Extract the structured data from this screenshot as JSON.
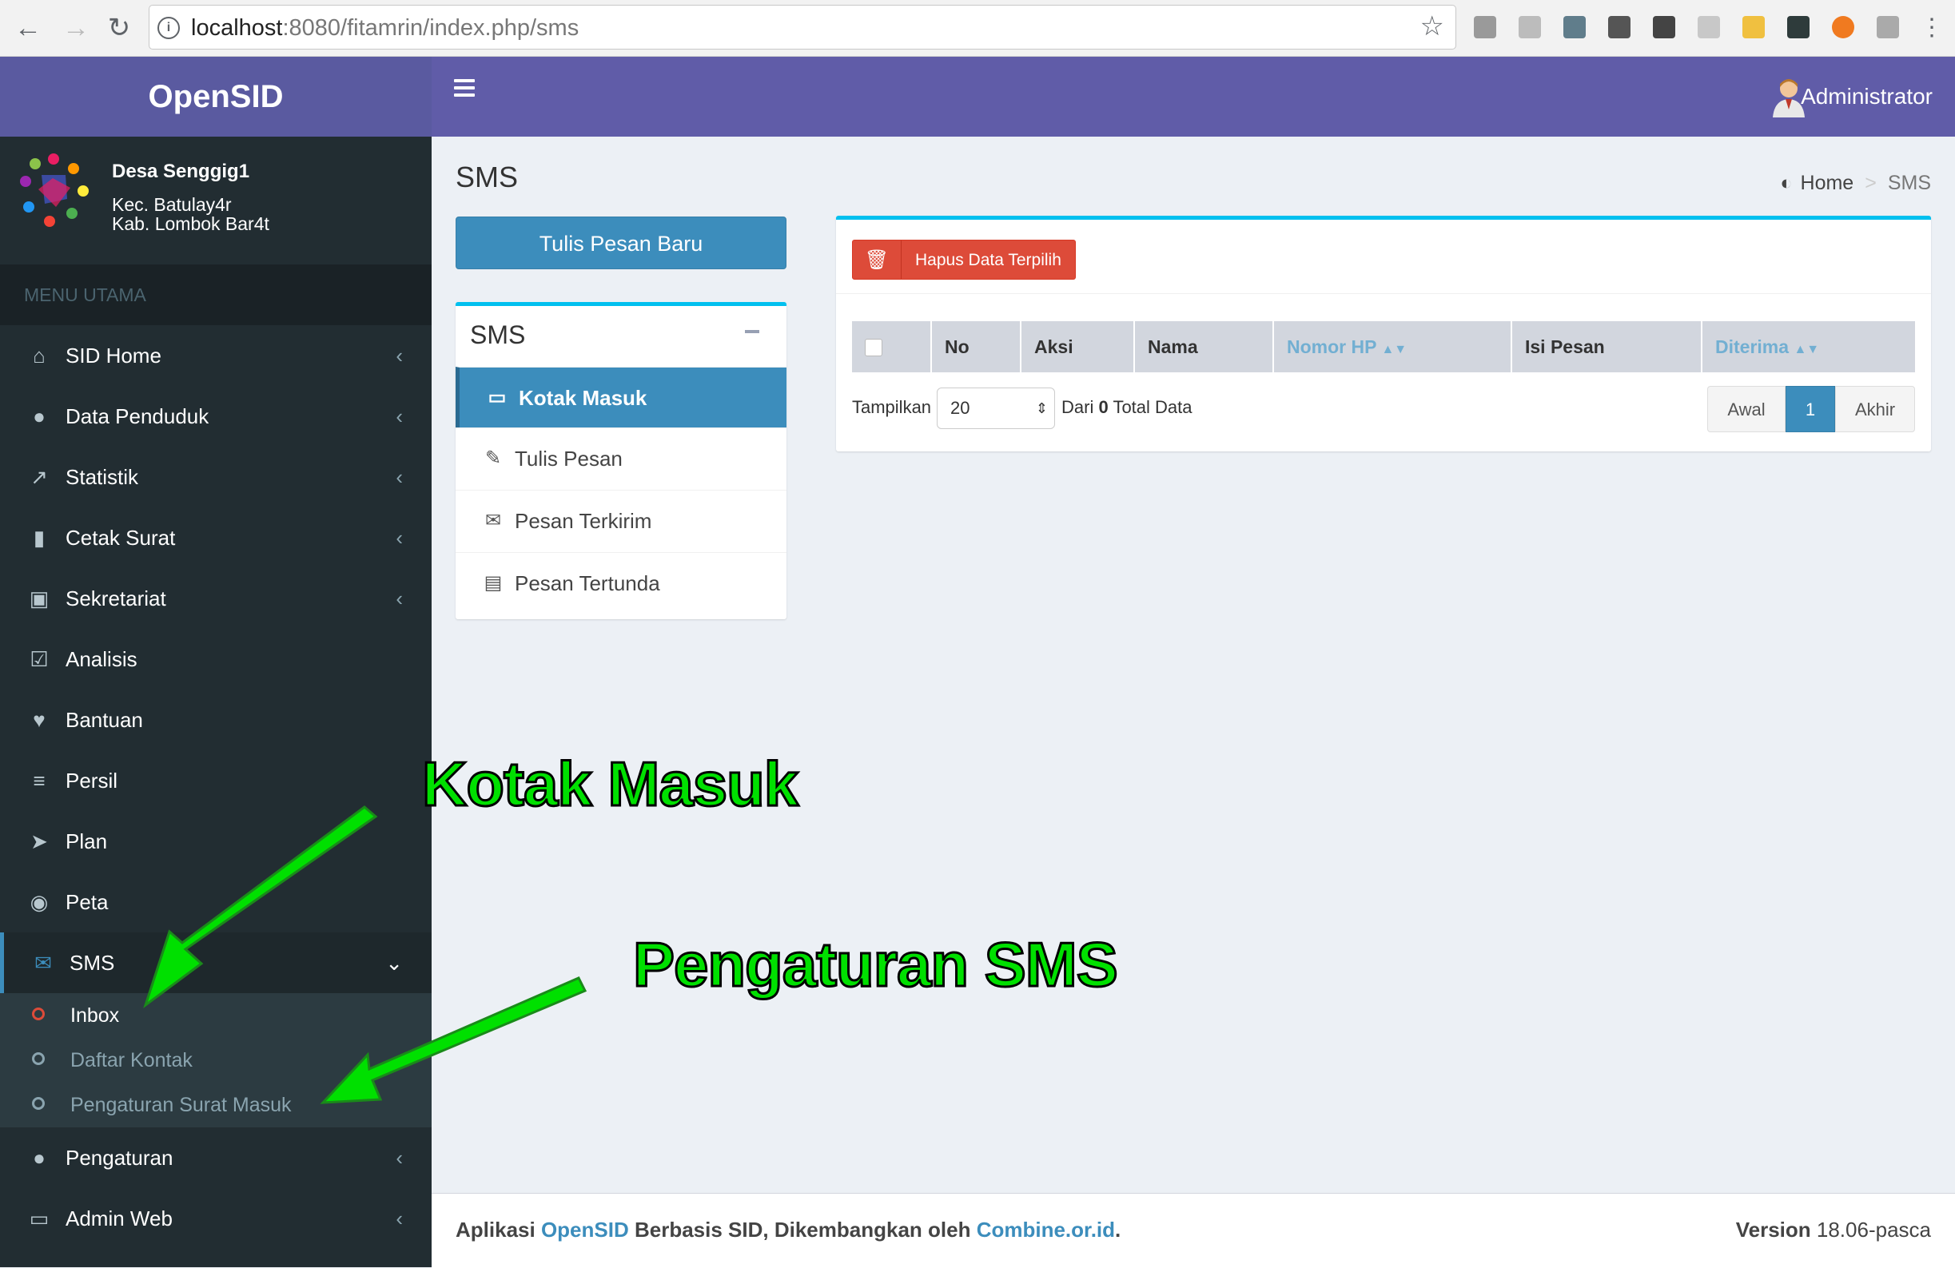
{
  "browser": {
    "url_host": "localhost",
    "url_rest": ":8080/fitamrin/index.php/sms"
  },
  "app": {
    "logo_text": "OpenSID",
    "user": "Administrator"
  },
  "desa": {
    "name": "Desa Senggig1",
    "kec": "Kec. Batulay4r",
    "kab": "Kab. Lombok Bar4t"
  },
  "sidebar": {
    "header": "MENU UTAMA",
    "items": [
      {
        "label": "SID Home",
        "icon": "home-icon",
        "chevron": true
      },
      {
        "label": "Data Penduduk",
        "icon": "users-icon",
        "chevron": true
      },
      {
        "label": "Statistik",
        "icon": "chart-line-icon",
        "chevron": true
      },
      {
        "label": "Cetak Surat",
        "icon": "book-icon",
        "chevron": true
      },
      {
        "label": "Sekretariat",
        "icon": "archive-icon",
        "chevron": true
      },
      {
        "label": "Analisis",
        "icon": "check-square-icon",
        "chevron": false
      },
      {
        "label": "Bantuan",
        "icon": "heart-icon",
        "chevron": false
      },
      {
        "label": "Persil",
        "icon": "signpost-icon",
        "chevron": false
      },
      {
        "label": "Plan",
        "icon": "location-arrow-icon",
        "chevron": false
      },
      {
        "label": "Peta",
        "icon": "globe-icon",
        "chevron": false
      },
      {
        "label": "SMS",
        "icon": "envelope-icon",
        "chevron": true
      },
      {
        "label": "Pengaturan",
        "icon": "users-cog-icon",
        "chevron": true
      },
      {
        "label": "Admin Web",
        "icon": "desktop-icon",
        "chevron": true
      }
    ],
    "sms_submenu": [
      {
        "label": "Inbox"
      },
      {
        "label": "Daftar Kontak"
      },
      {
        "label": "Pengaturan Surat Masuk"
      }
    ]
  },
  "page": {
    "title": "SMS",
    "breadcrumb_home": "Home",
    "breadcrumb_current": "SMS"
  },
  "compose_button": "Tulis Pesan Baru",
  "folders": {
    "title": "SMS",
    "items": [
      {
        "label": "Kotak Masuk",
        "icon": "inbox-icon"
      },
      {
        "label": "Tulis Pesan",
        "icon": "pencil-icon"
      },
      {
        "label": "Pesan Terkirim",
        "icon": "envelope-outline-icon"
      },
      {
        "label": "Pesan Tertunda",
        "icon": "file-icon"
      }
    ]
  },
  "table": {
    "delete_button": "Hapus Data Terpilih",
    "columns": [
      "No",
      "Aksi",
      "Nama",
      "Nomor HP",
      "Isi Pesan",
      "Diterima"
    ],
    "show_label": "Tampilkan",
    "page_length": "20",
    "total_prefix": "Dari",
    "total_count": "0",
    "total_suffix": "Total Data",
    "pager": {
      "first": "Awal",
      "current": "1",
      "last": "Akhir"
    }
  },
  "footer": {
    "prefix": "Aplikasi",
    "app": "OpenSID",
    "middle": "Berbasis SID, Dikembangkan oleh",
    "org": "Combine.or.id",
    "suffix": ".",
    "version_label": "Version",
    "version_value": "18.06-pasca"
  },
  "annotations": {
    "kotak_masuk": "Kotak Masuk",
    "pengaturan_sms": "Pengaturan SMS"
  },
  "colors": {
    "topbar": "#605ca8",
    "sidebar": "#222d32",
    "primary": "#3c8dbc",
    "danger": "#dd4b39",
    "annotation": "#00e000"
  }
}
